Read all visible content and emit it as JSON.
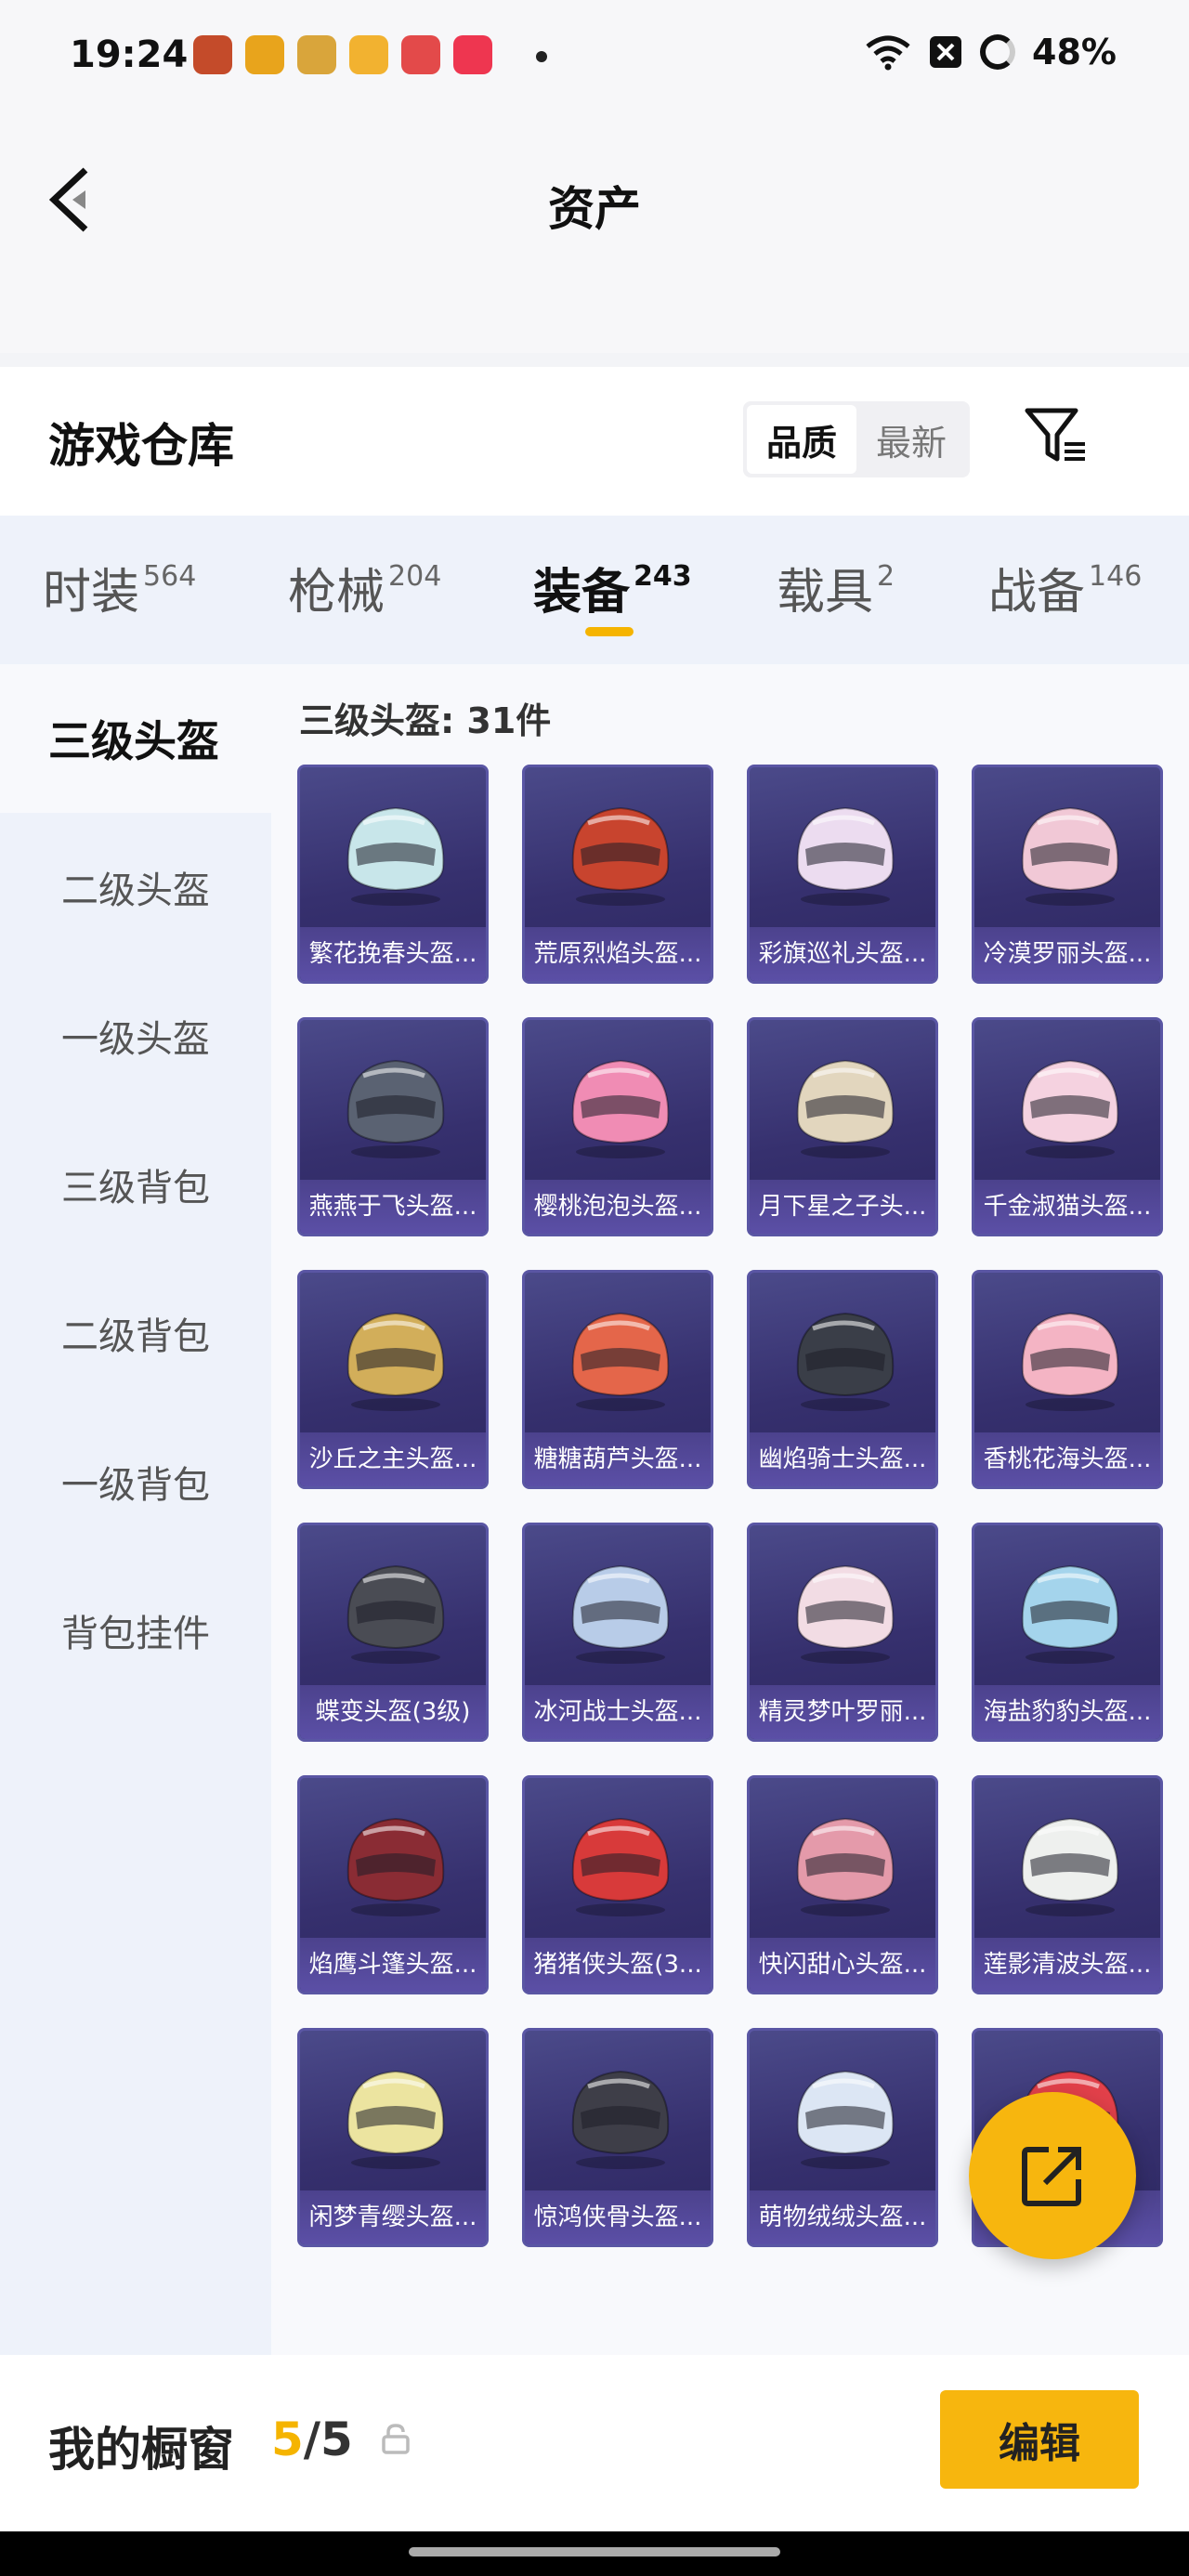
{
  "status_bar": {
    "time": "19:24",
    "battery": "48%"
  },
  "header": {
    "title": "资产"
  },
  "section": {
    "title": "游戏仓库",
    "sort_options": [
      "品质",
      "最新"
    ],
    "active_sort": "品质"
  },
  "category_tabs": [
    {
      "label": "时装",
      "count": "564",
      "active": false
    },
    {
      "label": "枪械",
      "count": "204",
      "active": false
    },
    {
      "label": "装备",
      "count": "243",
      "active": true
    },
    {
      "label": "载具",
      "count": "2",
      "active": false
    },
    {
      "label": "战备",
      "count": "146",
      "active": false
    }
  ],
  "sidebar": {
    "items": [
      "三级头盔",
      "二级头盔",
      "一级头盔",
      "三级背包",
      "二级背包",
      "一级背包",
      "背包挂件"
    ],
    "active_index": 0
  },
  "grid": {
    "heading": "三级头盔: 31件",
    "items": [
      {
        "label": "繁花挽春头盔...",
        "color": "#c8e6ea"
      },
      {
        "label": "荒原烈焰头盔...",
        "color": "#c8442e"
      },
      {
        "label": "彩旗巡礼头盔...",
        "color": "#ecdcf0"
      },
      {
        "label": "冷漠罗丽头盔...",
        "color": "#f1c8d6"
      },
      {
        "label": "燕燕于飞头盔...",
        "color": "#5a6272"
      },
      {
        "label": "樱桃泡泡头盔...",
        "color": "#f08cb4"
      },
      {
        "label": "月下星之子头...",
        "color": "#e2d6be"
      },
      {
        "label": "千金淑猫头盔...",
        "color": "#f5d2e0"
      },
      {
        "label": "沙丘之主头盔...",
        "color": "#d2ae5a"
      },
      {
        "label": "糖糖葫芦头盔...",
        "color": "#e4664a"
      },
      {
        "label": "幽焰骑士头盔...",
        "color": "#3a3e48"
      },
      {
        "label": "香桃花海头盔...",
        "color": "#f4b4c4"
      },
      {
        "label": "蝶变头盔(3级)",
        "color": "#4a4c54"
      },
      {
        "label": "冰河战士头盔...",
        "color": "#b8cce8"
      },
      {
        "label": "精灵梦叶罗丽...",
        "color": "#f2dce4"
      },
      {
        "label": "海盐豹豹头盔...",
        "color": "#a4d4ec"
      },
      {
        "label": "焰鹰斗篷头盔...",
        "color": "#8a2c34"
      },
      {
        "label": "猪猪侠头盔(3...",
        "color": "#d83a3a"
      },
      {
        "label": "快闪甜心头盔...",
        "color": "#e49aaa"
      },
      {
        "label": "莲影清波头盔...",
        "color": "#eef0ee"
      },
      {
        "label": "闲梦青缨头盔...",
        "color": "#ece4a0"
      },
      {
        "label": "惊鸿侠骨头盔...",
        "color": "#3e3e48"
      },
      {
        "label": "萌物绒绒头盔...",
        "color": "#dce6f4"
      },
      {
        "label": "",
        "color": "#e2404a"
      }
    ]
  },
  "bottom_bar": {
    "label": "我的橱窗",
    "current": "5",
    "total": "/5",
    "edit_label": "编辑"
  }
}
